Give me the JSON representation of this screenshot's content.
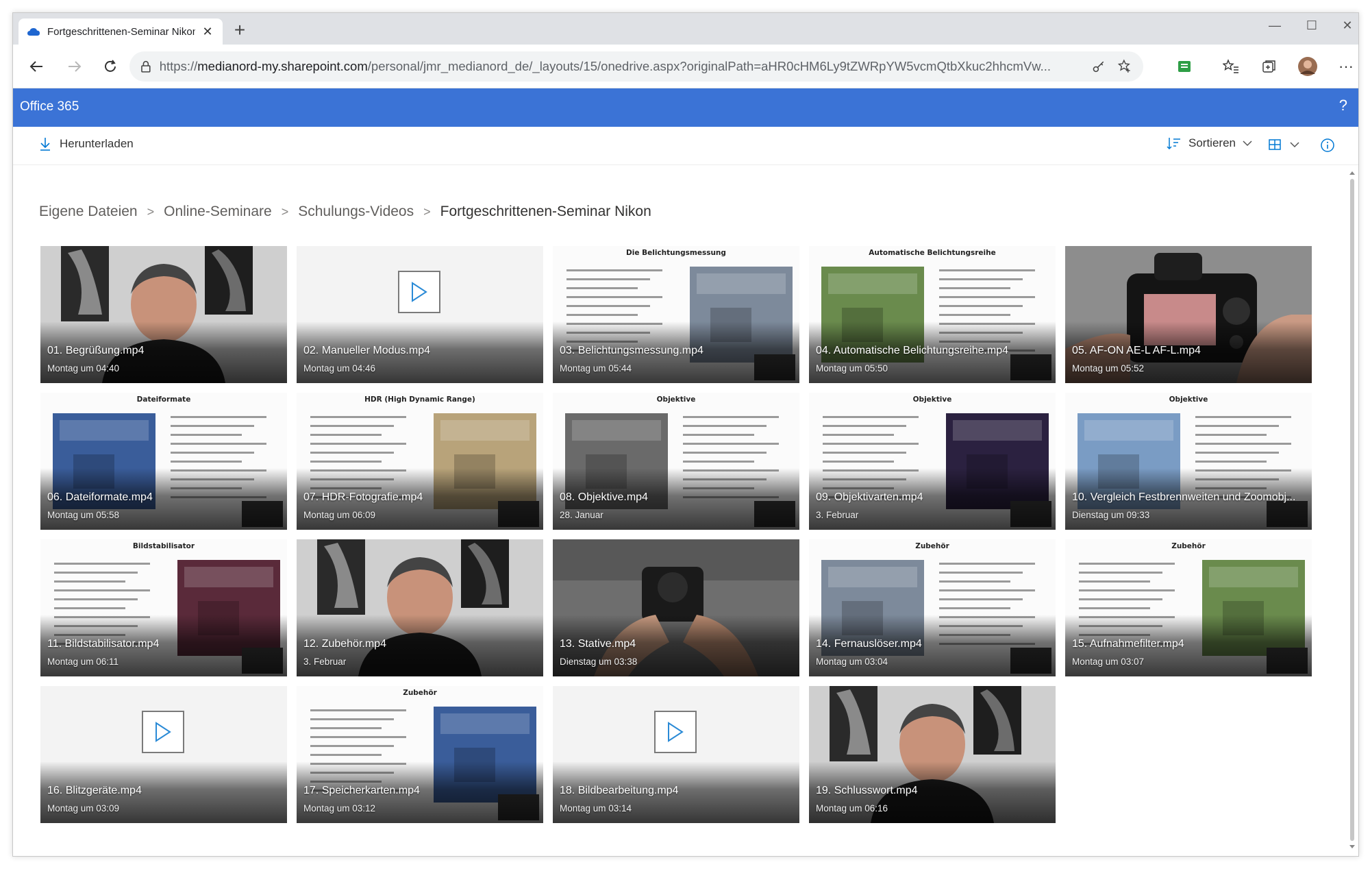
{
  "browser": {
    "tab_title": "Fortgeschrittenen-Seminar Nikon",
    "url_prefix": "https://",
    "url_host": "medianord-my.sharepoint.com",
    "url_path": "/personal/jmr_medianord_de/_layouts/15/onedrive.aspx?originalPath=aHR0cHM6Ly9tZWRpYW5vcmQtbXkuc2hhcmVw..."
  },
  "o365": {
    "brand": "Office 365",
    "help": "?"
  },
  "commands": {
    "download": "Herunterladen",
    "sort": "Sortieren"
  },
  "breadcrumb": {
    "items": [
      "Eigene Dateien",
      "Online-Seminare",
      "Schulungs-Videos"
    ],
    "current": "Fortgeschrittenen-Seminar Nikon"
  },
  "files": [
    {
      "name": "01. Begrüßung.mp4",
      "date": "Montag um 04:40",
      "thumb": "person",
      "slide_title": ""
    },
    {
      "name": "02. Manueller Modus.mp4",
      "date": "Montag um 04:46",
      "thumb": "placeholder",
      "slide_title": ""
    },
    {
      "name": "03. Belichtungsmessung.mp4",
      "date": "Montag um 05:44",
      "thumb": "slide",
      "slide_title": "Die Belichtungsmessung"
    },
    {
      "name": "04. Automatische Belichtungsreihe.mp4",
      "date": "Montag um 05:50",
      "thumb": "slide",
      "slide_title": "Automatische Belichtungsreihe"
    },
    {
      "name": "05. AF-ON AE-L AF-L.mp4",
      "date": "Montag um 05:52",
      "thumb": "camera",
      "slide_title": ""
    },
    {
      "name": "06. Dateiformate.mp4",
      "date": "Montag um 05:58",
      "thumb": "slide",
      "slide_title": "Dateiformate"
    },
    {
      "name": "07. HDR-Fotografie.mp4",
      "date": "Montag um 06:09",
      "thumb": "slide",
      "slide_title": "HDR (High Dynamic Range)"
    },
    {
      "name": "08. Objektive.mp4",
      "date": "28. Januar",
      "thumb": "slide",
      "slide_title": "Objektive"
    },
    {
      "name": "09. Objektivarten.mp4",
      "date": "3. Februar",
      "thumb": "slide",
      "slide_title": "Objektive"
    },
    {
      "name": "10. Vergleich Festbrennweiten und Zoomobj...",
      "date": "Dienstag um 09:33",
      "thumb": "slide",
      "slide_title": "Objektive"
    },
    {
      "name": "11. Bildstabilisator.mp4",
      "date": "Montag um 06:11",
      "thumb": "slide",
      "slide_title": "Bildstabilisator"
    },
    {
      "name": "12. Zubehör.mp4",
      "date": "3. Februar",
      "thumb": "person",
      "slide_title": ""
    },
    {
      "name": "13. Stative.mp4",
      "date": "Dienstag um 03:38",
      "thumb": "hands",
      "slide_title": ""
    },
    {
      "name": "14. Fernauslöser.mp4",
      "date": "Montag um 03:04",
      "thumb": "slide",
      "slide_title": "Zubehör"
    },
    {
      "name": "15. Aufnahmefilter.mp4",
      "date": "Montag um 03:07",
      "thumb": "slide",
      "slide_title": "Zubehör"
    },
    {
      "name": "16. Blitzgeräte.mp4",
      "date": "Montag um 03:09",
      "thumb": "placeholder",
      "slide_title": ""
    },
    {
      "name": "17. Speicherkarten.mp4",
      "date": "Montag um 03:12",
      "thumb": "slide",
      "slide_title": "Zubehör"
    },
    {
      "name": "18. Bildbearbeitung.mp4",
      "date": "Montag um 03:14",
      "thumb": "placeholder",
      "slide_title": ""
    },
    {
      "name": "19. Schlusswort.mp4",
      "date": "Montag um 06:16",
      "thumb": "person",
      "slide_title": ""
    }
  ],
  "colors": {
    "o365_bar": "#3b73d6",
    "tab_strip": "#dfe1e5"
  }
}
